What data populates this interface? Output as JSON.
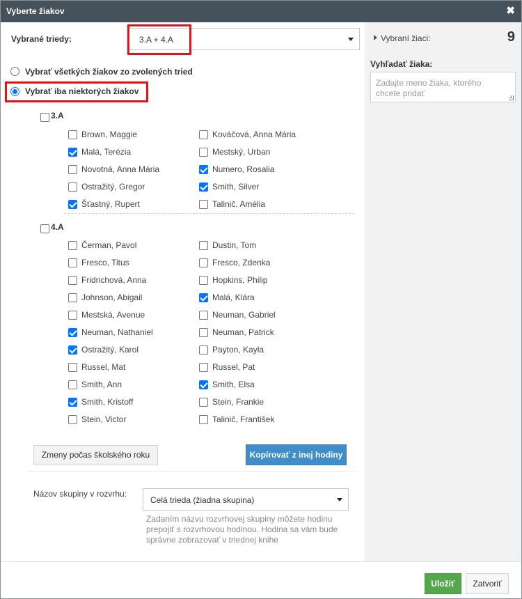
{
  "dialog": {
    "title": "Vyberte žiakov",
    "close_icon": "✖"
  },
  "classes_select": {
    "label": "Vybrané triedy:",
    "value": "3.A + 4.A"
  },
  "mode": {
    "all_label": "Vybrať všetkých žiakov zo zvolených tried",
    "some_label": "Vybrať iba niektorých žiakov",
    "selected": "some"
  },
  "groups": [
    {
      "name": "3.A",
      "checked": false,
      "students": [
        {
          "name": "Brown, Maggie",
          "checked": false
        },
        {
          "name": "Kováčová, Anna Mária",
          "checked": false
        },
        {
          "name": "Malá, Terézia",
          "checked": true
        },
        {
          "name": "Mestský, Urban",
          "checked": false
        },
        {
          "name": "Novotná, Anna Mária",
          "checked": false
        },
        {
          "name": "Numero, Rosalia",
          "checked": true
        },
        {
          "name": "Ostražitý, Gregor",
          "checked": false
        },
        {
          "name": "Smith, Silver",
          "checked": true
        },
        {
          "name": "Šťastný, Rupert",
          "checked": true
        },
        {
          "name": "Talinič, Amélia",
          "checked": false
        }
      ]
    },
    {
      "name": "4.A",
      "checked": false,
      "students": [
        {
          "name": "Čerman, Pavol",
          "checked": false
        },
        {
          "name": "Dustin, Tom",
          "checked": false
        },
        {
          "name": "Fresco, Titus",
          "checked": false
        },
        {
          "name": "Fresco, Zdenka",
          "checked": false
        },
        {
          "name": "Fridrichová, Anna",
          "checked": false
        },
        {
          "name": "Hopkins, Philip",
          "checked": false
        },
        {
          "name": "Johnson, Abigail",
          "checked": false
        },
        {
          "name": "Malá, Klára",
          "checked": true
        },
        {
          "name": "Mestská, Avenue",
          "checked": false
        },
        {
          "name": "Neuman, Gabriel",
          "checked": false
        },
        {
          "name": "Neuman, Nathaniel",
          "checked": true
        },
        {
          "name": "Neuman, Patrick",
          "checked": false
        },
        {
          "name": "Ostražitý, Karol",
          "checked": true
        },
        {
          "name": "Payton, Kayla",
          "checked": false
        },
        {
          "name": "Russel, Mat",
          "checked": false
        },
        {
          "name": "Russel, Pat",
          "checked": false
        },
        {
          "name": "Smith, Ann",
          "checked": false
        },
        {
          "name": "Smith, Elsa",
          "checked": true
        },
        {
          "name": "Smith, Kristoff",
          "checked": true
        },
        {
          "name": "Stein, Frankie",
          "checked": false
        },
        {
          "name": "Stein, Victor",
          "checked": false
        },
        {
          "name": "Talinič, František",
          "checked": false
        }
      ]
    }
  ],
  "actions": {
    "changes_label": "Zmeny počas školského roku",
    "copy_label": "Kopírovať z inej hodiny"
  },
  "group_name": {
    "label": "Názov skupiny v rozvrhu:",
    "value": "Celá trieda (žiadna skupina)",
    "hint": "Zadaním názvu rozvrhovej skupiny môžete hodinu prepojiť s rozvrhovou hodinou. Hodina sa vám bude správne zobrazovať v triednej knihe"
  },
  "sidebar": {
    "selected_label": "Vybraní žiaci:",
    "selected_count": "9",
    "search_label": "Vyhľadať žiaka:",
    "search_placeholder": "Zadajte meno žiaka, ktorého chcete pridať"
  },
  "footer": {
    "save_label": "Uložiť",
    "close_label": "Zatvoriť"
  },
  "colors": {
    "titlebar": "#45525c",
    "highlight": "#e3121b",
    "primary": "#3f8ec9",
    "save": "#52a84a"
  }
}
